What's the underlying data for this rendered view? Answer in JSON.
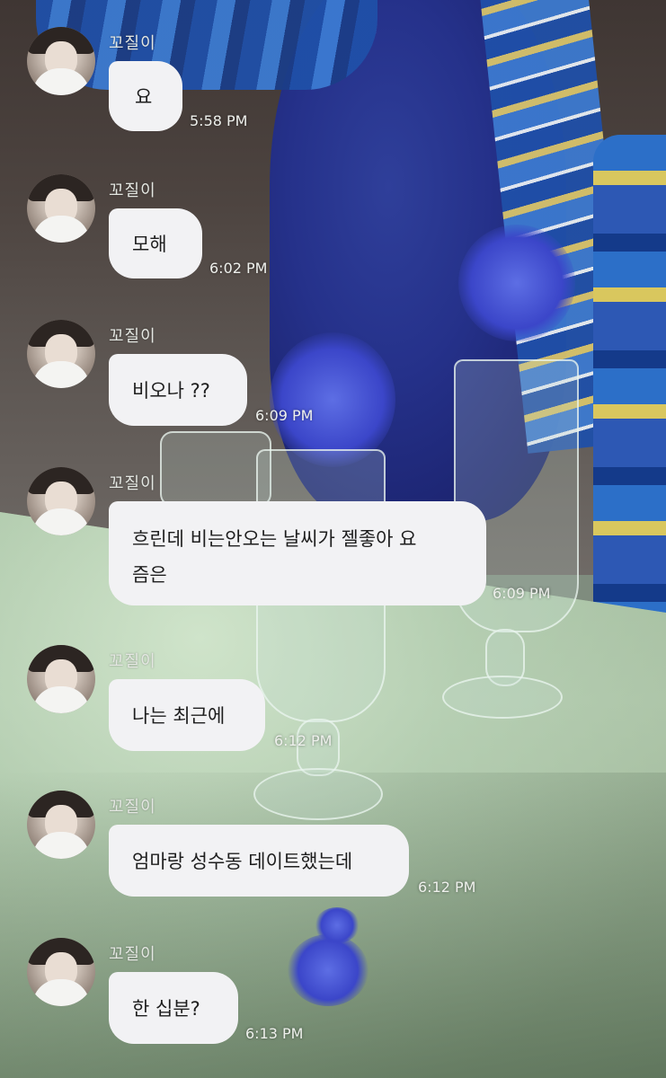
{
  "messages": [
    {
      "sender": "꼬질이",
      "text": "요",
      "time": "5:58 PM"
    },
    {
      "sender": "꼬질이",
      "text": "모해",
      "time": "6:02 PM"
    },
    {
      "sender": "꼬질이",
      "text": "비오나 ??",
      "time": "6:09 PM"
    },
    {
      "sender": "꼬질이",
      "text": "흐린데 비는안오는 날씨가 젤좋아 요\n즘은",
      "time": "6:09 PM"
    },
    {
      "sender": "꼬질이",
      "text": "나는 최근에",
      "time": "6:12 PM"
    },
    {
      "sender": "꼬질이",
      "text": "엄마랑 성수동 데이트했는데",
      "time": "6:12 PM"
    },
    {
      "sender": "꼬질이",
      "text": "한 십분?",
      "time": "6:13 PM"
    }
  ],
  "colors": {
    "bubble": "#f2f2f4",
    "bubble_text": "#1e1e1e",
    "meta_text": "#e4e7e2"
  }
}
